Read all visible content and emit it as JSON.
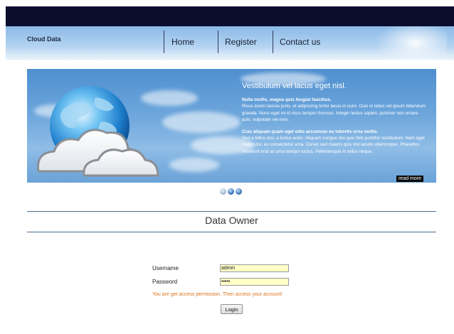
{
  "header": {
    "brand": "Cloud Data",
    "nav": [
      {
        "label": "Home"
      },
      {
        "label": "Register"
      },
      {
        "label": "Contact us"
      }
    ]
  },
  "banner": {
    "title": "Vestibulum vel lacus eget nisl.",
    "paragraphs": [
      {
        "heading": "Nulla mollis, magna quis feugiat faucibus.",
        "text": "Risus lorem lacinia justo, et adipiscing tortor lacus in nunc. Duis in tellus vel ipsum bibendum gravida. Nunc eget mi id risus tempor rhoncus. Integer lectus sapien, pulvinar non ornare quis, vulputate vel eros."
      },
      {
        "heading": "Cras aliquam quam eget odio accumsan eu lobortis urna mollis.",
        "text": "Sed a tellus orci, a luctus enim. Aliquam congue nisi quis felis porttitor vestibulum. Nam eget metus dui, eu consectetur urna. Donec sed mauris quis nisl iaculis ullamcorper. Phasellus hendrerit erat ac urna tempor luctus. Pellentesque in tellus neque."
      }
    ],
    "read_more": "read more",
    "slide_count": 3,
    "active_slide": 0
  },
  "section": {
    "title": "Data Owner"
  },
  "form": {
    "username_label": "Username",
    "username_value": "admin",
    "password_label": "Password",
    "password_value": "admin",
    "notice": "You are get access permission. Then access your account!",
    "login_label": "Login",
    "notice_color": "#d9721d",
    "input_bg": "#ffffc6"
  }
}
